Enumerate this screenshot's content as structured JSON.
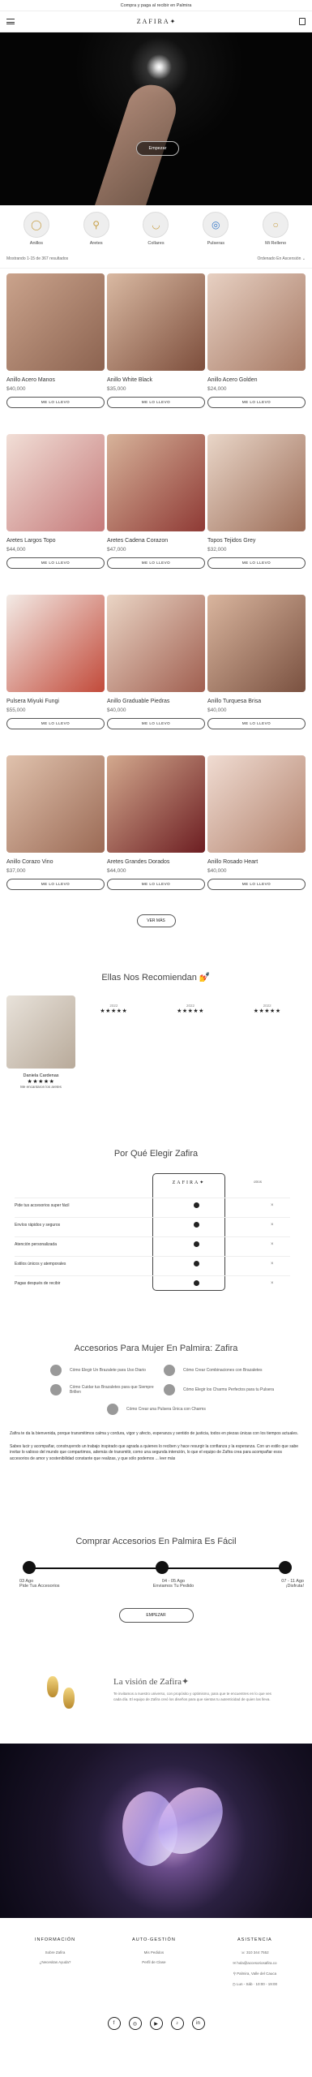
{
  "topbar": {
    "text": "Compra y paga al recibir en Palmira"
  },
  "header": {
    "logo": "ZAFIRA✦"
  },
  "hero": {
    "button": "Empezar"
  },
  "categories": [
    {
      "label": "Anillos",
      "icon": "ring-icon"
    },
    {
      "label": "Aretes",
      "icon": "earring-icon"
    },
    {
      "label": "Collares",
      "icon": "necklace-icon"
    },
    {
      "label": "Pulseras",
      "icon": "bracelet-icon"
    },
    {
      "label": "Mi Relleno",
      "icon": "pendant-icon"
    }
  ],
  "filter": {
    "count": "Mostrando 1-15 de 367 resultados",
    "sort": "Ordenado En Ascensión ⌄"
  },
  "products": [
    {
      "name": "Anillo Acero Manos",
      "price": "$40,000",
      "cta": "ME LO LLEVO"
    },
    {
      "name": "Anillo White Black",
      "price": "$35,000",
      "cta": "ME LO LLEVO"
    },
    {
      "name": "Anillo Acero Golden",
      "price": "$24,000",
      "cta": "ME LO LLEVO"
    },
    {
      "name": "Aretes Largos Topo",
      "price": "$44,000",
      "cta": "ME LO LLEVO"
    },
    {
      "name": "Aretes Cadena Corazon",
      "price": "$47,000",
      "cta": "ME LO LLEVO"
    },
    {
      "name": "Topos Tejidos Grey",
      "price": "$32,000",
      "cta": "ME LO LLEVO"
    },
    {
      "name": "Pulsera Miyuki Fungi",
      "price": "$55,000",
      "cta": "ME LO LLEVO"
    },
    {
      "name": "Anillo Graduable Piedras",
      "price": "$40,000",
      "cta": "ME LO LLEVO"
    },
    {
      "name": "Anillo Turquesa Brisa",
      "price": "$40,000",
      "cta": "ME LO LLEVO"
    },
    {
      "name": "Anillo Corazo Vino",
      "price": "$37,000",
      "cta": "ME LO LLEVO"
    },
    {
      "name": "Aretes Grandes Dorados",
      "price": "$44,000",
      "cta": "ME LO LLEVO"
    },
    {
      "name": "Anillo Rosado Heart",
      "price": "$40,000",
      "cta": "ME LO LLEVO"
    }
  ],
  "more": "VER MÁS",
  "reviews": {
    "title": "Ellas Nos Recomiendan 💅",
    "main": {
      "name": "Daniela Cardenas",
      "stars": "★★★★★",
      "text": "Me encantaron los aretes"
    },
    "others": [
      {
        "date": "2022",
        "stars": "★★★★★"
      },
      {
        "date": "2022",
        "stars": "★★★★★"
      },
      {
        "date": "2022",
        "stars": "★★★★★"
      }
    ]
  },
  "why": {
    "title": "Por Qué Elegir Zafira",
    "brand": "ZAFIRA✦",
    "others_label": "otros",
    "rows": [
      "Pide tus accesorios super fácil",
      "Envíos rápidos y seguros",
      "Atención personalizada",
      "Estilos únicos y atemporales",
      "Pagas después de recibir"
    ]
  },
  "accesorios": {
    "title": "Accesorios Para Mujer En Palmira: Zafira",
    "links": [
      "Cómo Elegir Un Brazalete para Uso Diario",
      "Cómo Crear Combinaciones con Brazaletes",
      "Cómo Cuidar tus Brazaletes para que Siempre Brillen",
      "Cómo Elegir los Charms Perfectos para tu Pulsera",
      "Cómo Crear una Pulsera Única con Charms"
    ],
    "p1": "Zafira te da la bienvenida, porque transmitimos calma y cordura, vigor y afecto, esperanza y sentido de justicia, todos en piezas únicas con los tiempos actuales.",
    "p2": "Sabes lucir y acompañar, construyendo un trabajo inspirado que agrada a quienes lo reciben y hace resurgir la confianza y la esperanza. Con un estilo que sabe invitar lo valioso del mundo que compartimos, además de transmitir, como una segunda intención, lo que el equipo de Zafira crea para acompañar esos accesorios de amor y sostenibilidad constante que realizas, y que sólo podemos ... leer más"
  },
  "buy": {
    "title": "Comprar Accesorios En Palmira Es Fácil",
    "steps": [
      {
        "line1": "03 Ago",
        "line2": "Pide Tus Accesorios"
      },
      {
        "line1": "04 - 05 Ago",
        "line2": "Enviamos Tu Pedido"
      },
      {
        "line1": "07 - 11 Ago",
        "line2": "¡Disfruta!"
      }
    ],
    "cta": "EMPEZAR"
  },
  "vision": {
    "title": "La visión de Zafira✦",
    "text": "Te invitamos a nuestro universo, con propósito y optimismo, para que te encuentres en lo que ves cada día. El equipo de Zafira creó los diseños para que sientas tu autenticidad de quien las lleva."
  },
  "footer": {
    "cols": [
      {
        "title": "INFORMACIÓN",
        "items": [
          "Sobre Zafira",
          "¿Necesitas Ayuda?"
        ]
      },
      {
        "title": "AUTO-GESTIÓN",
        "items": [
          "Mis Pedidos",
          "Perfil de Clase"
        ]
      },
      {
        "title": "ASISTENCIA",
        "items": [
          "☏ 310 344 7552",
          "✉ hola@accesoriosafira.co",
          "⚲ Palmira, Valle del Cauca",
          "◷ Lun - Sáb · 10:00 - 19:00"
        ]
      }
    ],
    "social": [
      "f",
      "◎",
      "▶",
      "♪",
      "in"
    ]
  }
}
